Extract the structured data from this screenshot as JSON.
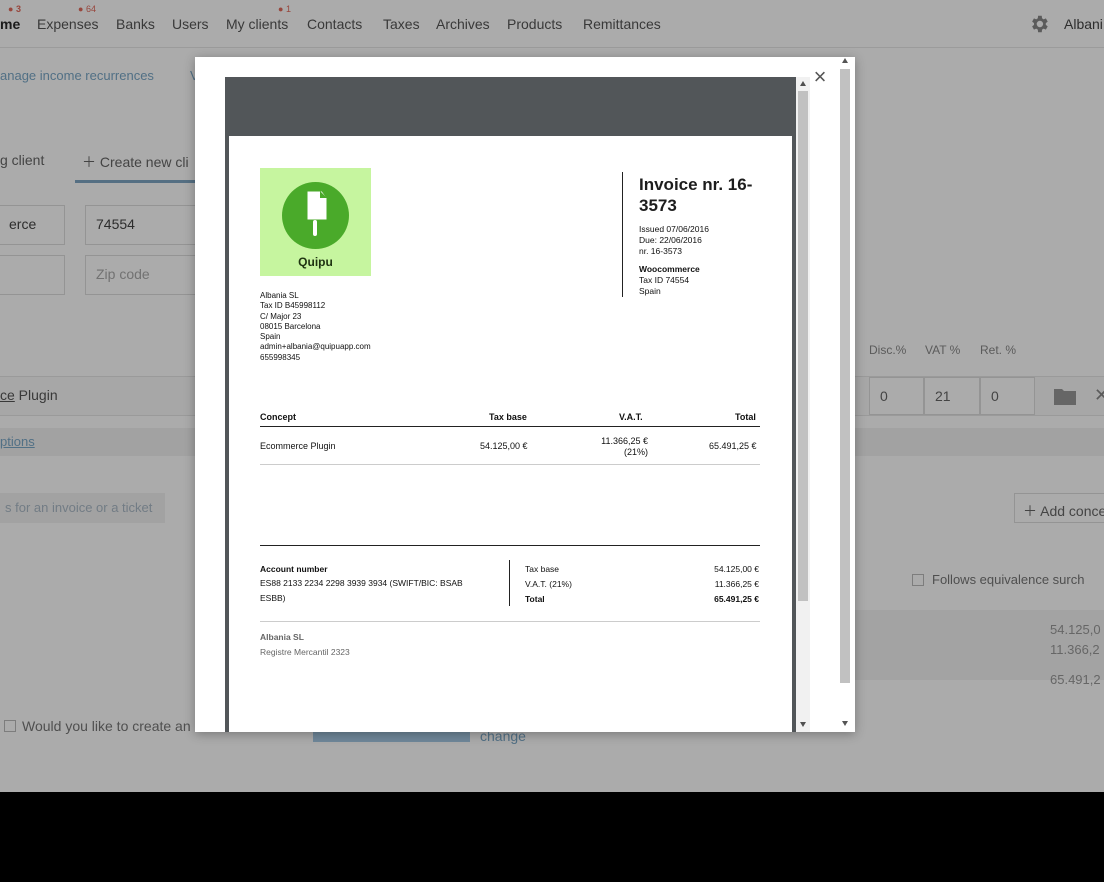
{
  "nav": {
    "items": [
      {
        "label": "me",
        "badge": "3"
      },
      {
        "label": "Expenses",
        "badge": "64"
      },
      {
        "label": "Banks",
        "badge": ""
      },
      {
        "label": "Users",
        "badge": ""
      },
      {
        "label": "My clients",
        "badge": "1"
      },
      {
        "label": "Contacts",
        "badge": ""
      },
      {
        "label": "Taxes",
        "badge": ""
      },
      {
        "label": "Archives",
        "badge": ""
      },
      {
        "label": "Products",
        "badge": ""
      },
      {
        "label": "Remittances",
        "badge": ""
      }
    ],
    "user": "Albani"
  },
  "subnav": {
    "link1": "anage income recurrences",
    "link2": "V"
  },
  "tabs": {
    "existing": "g client",
    "create": "Create new cli"
  },
  "form": {
    "client_partial": "erce",
    "tax_id": "74554",
    "zip_placeholder": "Zip code"
  },
  "columns": {
    "disc": "Disc.%",
    "vat": "VAT %",
    "ret": "Ret. %"
  },
  "concept_row": {
    "text_prefix": "ce",
    "text_rest": " Plugin",
    "disc": "0",
    "vat": "21",
    "ret": "0"
  },
  "options_link": "ptions",
  "search_ghost": "s for an invoice or a ticket",
  "add_concept": "Add conce",
  "equivalence": "Follows equivalence surch",
  "bg_totals": [
    "54.125,0",
    "11.366,2",
    "65.491,2"
  ],
  "bottom_check": "Would you like to create an",
  "change_link": "change",
  "modal": {
    "close_symbol": "×"
  },
  "invoice": {
    "title": "Invoice nr. 16-3573",
    "issued": "Issued 07/06/2016",
    "due": "Due: 22/06/2016",
    "number": "nr. 16-3573",
    "logo_text": "Quipu",
    "issuer": {
      "name": "Albania SL",
      "tax_id": "Tax ID B45998112",
      "street": "C/ Major 23",
      "city": "08015 Barcelona",
      "country": "Spain",
      "email": "admin+albania@quipuapp.com",
      "phone": "655998345"
    },
    "client": {
      "name": "Woocommerce",
      "tax_id": "Tax ID 74554",
      "country": "Spain"
    },
    "table": {
      "headers": [
        "Concept",
        "Tax base",
        "V.A.T.",
        "Total"
      ],
      "rows": [
        {
          "concept": "Ecommerce Plugin",
          "tax_base": "54.125,00 €",
          "vat": "11.366,25 €",
          "vat_rate": "(21%)",
          "total": "65.491,25 €"
        }
      ]
    },
    "account": {
      "label": "Account number",
      "value": "ES88 2133 2234 2298 3939 3934 (SWIFT/BIC: BSAB ESBB)"
    },
    "summary": [
      {
        "label": "Tax base",
        "value": "54.125,00 €"
      },
      {
        "label": "V.A.T. (21%)",
        "value": "11.366,25 €"
      },
      {
        "label": "Total",
        "value": "65.491,25 €"
      }
    ],
    "company": "Albania SL",
    "registry": "Registre Mercantil 2323"
  }
}
